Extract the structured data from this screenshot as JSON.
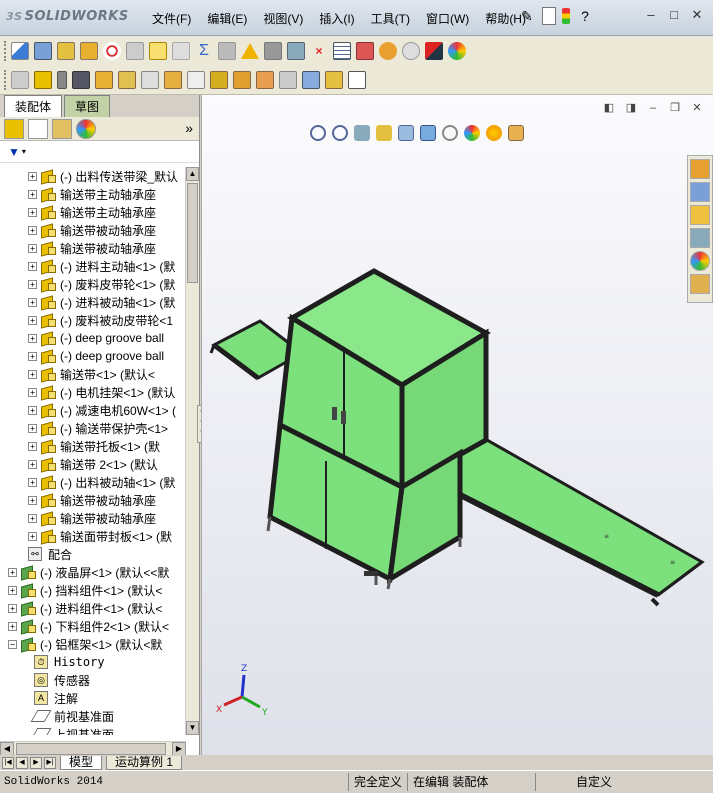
{
  "app": {
    "logo": "SOLIDWORKS",
    "logo_mark": "3S",
    "menu": [
      "文件(F)",
      "编辑(E)",
      "视图(V)",
      "插入(I)",
      "工具(T)",
      "窗口(W)",
      "帮助(H)"
    ]
  },
  "left_panel": {
    "tabs": [
      "装配体",
      "草图"
    ],
    "tree": [
      {
        "label": "(-) 出料传送带梁_默认",
        "type": "part",
        "level": 1
      },
      {
        "label": "输送带主动轴承座",
        "type": "part",
        "level": 1
      },
      {
        "label": "输送带主动轴承座",
        "type": "part",
        "level": 1
      },
      {
        "label": "输送带被动轴承座",
        "type": "part",
        "level": 1
      },
      {
        "label": "输送带被动轴承座",
        "type": "part",
        "level": 1
      },
      {
        "label": "(-) 进料主动轴<1> (默",
        "type": "part",
        "level": 1
      },
      {
        "label": "(-) 废料皮带轮<1> (默",
        "type": "part",
        "level": 1
      },
      {
        "label": "(-) 进料被动轴<1> (默",
        "type": "part",
        "level": 1
      },
      {
        "label": "(-) 废料被动皮带轮<1",
        "type": "part",
        "level": 1
      },
      {
        "label": "(-) deep groove ball",
        "type": "part",
        "level": 1
      },
      {
        "label": "(-) deep groove ball",
        "type": "part",
        "level": 1
      },
      {
        "label": "输送带<1> (默认<",
        "type": "part",
        "level": 1
      },
      {
        "label": "(-) 电机挂架<1> (默认",
        "type": "part",
        "level": 1
      },
      {
        "label": "(-) 减速电机60W<1> (",
        "type": "part",
        "level": 1
      },
      {
        "label": "(-) 输送带保护壳<1>",
        "type": "part",
        "level": 1
      },
      {
        "label": "输送带托板<1> (默",
        "type": "part",
        "level": 1
      },
      {
        "label": "输送带 2<1> (默认",
        "type": "part",
        "level": 1
      },
      {
        "label": "(-) 出料被动轴<1> (默",
        "type": "part",
        "level": 1
      },
      {
        "label": "输送带被动轴承座",
        "type": "part",
        "level": 1
      },
      {
        "label": "输送带被动轴承座",
        "type": "part",
        "level": 1
      },
      {
        "label": "输送面带封板<1> (默",
        "type": "part",
        "level": 1
      },
      {
        "label": "配合",
        "type": "mate",
        "level": 1
      },
      {
        "label": "(-) 液晶屏<1> (默认<<默",
        "type": "asm",
        "level": 0
      },
      {
        "label": "(-) 挡料组件<1> (默认<",
        "type": "asm",
        "level": 0
      },
      {
        "label": "(-) 进料组件<1> (默认<",
        "type": "asm",
        "level": 0
      },
      {
        "label": "(-) 下料组件2<1> (默认<",
        "type": "asm",
        "level": 0
      },
      {
        "label": "(-) 铝框架<1> (默认<默",
        "type": "asm",
        "level": 0,
        "expanded": true
      },
      {
        "label": "History",
        "type": "history",
        "level": 1
      },
      {
        "label": "传感器",
        "type": "sensor",
        "level": 1
      },
      {
        "label": "注解",
        "type": "note",
        "level": 1
      },
      {
        "label": "前视基准面",
        "type": "plane",
        "level": 1
      },
      {
        "label": "上视基准面",
        "type": "plane",
        "level": 1
      }
    ]
  },
  "bottom_tabs": [
    "模型",
    "运动算例 1"
  ],
  "status": {
    "app_name": "SolidWorks 2014",
    "state": "完全定义",
    "mode": "在编辑 装配体",
    "units": "自定义"
  },
  "colors": {
    "model_green": "#7ce07c",
    "frame_dark": "#2a2a2a"
  }
}
